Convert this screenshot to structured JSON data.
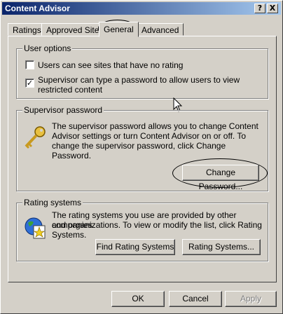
{
  "window": {
    "title": "Content Advisor",
    "help_label": "?",
    "close_label": "X"
  },
  "tabs": [
    {
      "label": "Ratings"
    },
    {
      "label": "Approved Sites"
    },
    {
      "label": "General",
      "active": true
    },
    {
      "label": "Advanced"
    }
  ],
  "user_options": {
    "title": "User options",
    "items": [
      {
        "label": "Users can see sites that have no rating",
        "checked": false,
        "mark": ""
      },
      {
        "label_line1": "Supervisor can type a password to allow users to view",
        "label_line2": "restricted content",
        "checked": true,
        "mark": "✓"
      }
    ]
  },
  "supervisor": {
    "title": "Supervisor password",
    "lines": [
      "The supervisor password allows you to change Content",
      "Advisor settings or turn Content Advisor on or off. To",
      "change the supervisor password, click Change",
      "Password."
    ],
    "button": "Change Password..."
  },
  "rating_systems": {
    "title": "Rating systems",
    "lines": [
      "The rating systems you use are provided by other companies",
      "and organizations. To view or modify the list, click Rating",
      "Systems."
    ],
    "find_button": "Find Rating Systems",
    "systems_button": "Rating Systems..."
  },
  "footer": {
    "ok": "OK",
    "cancel": "Cancel",
    "apply": "Apply"
  },
  "colors": {
    "face": "#d4d0c8",
    "title_start": "#0a246a",
    "title_end": "#a6caf0"
  }
}
